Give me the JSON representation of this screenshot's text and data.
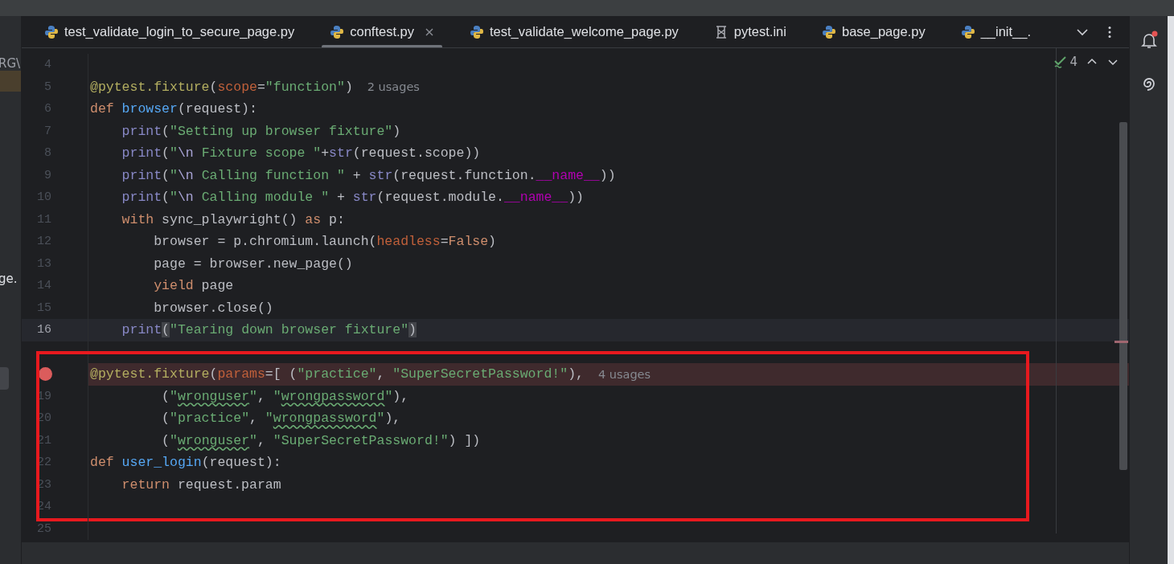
{
  "project_panel": {
    "path_fragment": "RG\\",
    "selected_row": true,
    "file_fragment": "ge."
  },
  "tabs": [
    {
      "label": "test_validate_login_to_secure_page.py",
      "kind": "python",
      "selected": false
    },
    {
      "label": "conftest.py",
      "kind": "python",
      "selected": true
    },
    {
      "label": "test_validate_welcome_page.py",
      "kind": "python",
      "selected": false
    },
    {
      "label": "pytest.ini",
      "kind": "ini",
      "selected": false
    },
    {
      "label": "base_page.py",
      "kind": "python",
      "selected": false
    },
    {
      "label": "__init__.",
      "kind": "python",
      "selected": false
    }
  ],
  "inspections": {
    "count": "4"
  },
  "code_blocks": [
    {
      "framed": false,
      "lines": [
        {
          "number": "4",
          "current": false,
          "breakpoint": false
        },
        {
          "number": "5",
          "current": false,
          "breakpoint": false,
          "tokens": [
            {
              "kind": "deco",
              "text": "@pytest.fixture"
            },
            {
              "kind": "plain",
              "text": "("
            },
            {
              "kind": "param",
              "text": "scope"
            },
            {
              "kind": "plain",
              "text": "="
            },
            {
              "kind": "str",
              "text": "\"function\""
            },
            {
              "kind": "plain",
              "text": ")"
            }
          ],
          "hint": "2 usages"
        },
        {
          "number": "6",
          "current": false,
          "breakpoint": false,
          "tokens": [
            {
              "kind": "kw",
              "text": "def "
            },
            {
              "kind": "def",
              "text": "browser"
            },
            {
              "kind": "plain",
              "text": "(request):"
            }
          ]
        },
        {
          "number": "7",
          "current": false,
          "breakpoint": false,
          "tokens": [
            {
              "kind": "builtin",
              "text": "    print"
            },
            {
              "kind": "plain",
              "text": "("
            },
            {
              "kind": "str",
              "text": "\"Setting up browser fixture\""
            },
            {
              "kind": "plain",
              "text": ")"
            }
          ]
        },
        {
          "number": "8",
          "current": false,
          "breakpoint": false,
          "tokens": [
            {
              "kind": "builtin",
              "text": "    print"
            },
            {
              "kind": "plain",
              "text": "("
            },
            {
              "kind": "str",
              "text": "\""
            },
            {
              "kind": "escape",
              "text": "\\n"
            },
            {
              "kind": "str",
              "text": " Fixture scope \""
            },
            {
              "kind": "plain",
              "text": "+"
            },
            {
              "kind": "builtin",
              "text": "str"
            },
            {
              "kind": "plain",
              "text": "(request.scope))"
            }
          ]
        },
        {
          "number": "9",
          "current": false,
          "breakpoint": false,
          "tokens": [
            {
              "kind": "builtin",
              "text": "    print"
            },
            {
              "kind": "plain",
              "text": "("
            },
            {
              "kind": "str",
              "text": "\""
            },
            {
              "kind": "escape",
              "text": "\\n"
            },
            {
              "kind": "str",
              "text": " Calling function \""
            },
            {
              "kind": "plain",
              "text": " + "
            },
            {
              "kind": "builtin",
              "text": "str"
            },
            {
              "kind": "plain",
              "text": "(request.function."
            },
            {
              "kind": "dunder",
              "text": "__name__"
            },
            {
              "kind": "plain",
              "text": "))"
            }
          ]
        },
        {
          "number": "10",
          "current": false,
          "breakpoint": false,
          "tokens": [
            {
              "kind": "builtin",
              "text": "    print"
            },
            {
              "kind": "plain",
              "text": "("
            },
            {
              "kind": "str",
              "text": "\""
            },
            {
              "kind": "escape",
              "text": "\\n"
            },
            {
              "kind": "str",
              "text": " Calling module \""
            },
            {
              "kind": "plain",
              "text": " + "
            },
            {
              "kind": "builtin",
              "text": "str"
            },
            {
              "kind": "plain",
              "text": "(request.module."
            },
            {
              "kind": "dunder",
              "text": "__name__"
            },
            {
              "kind": "plain",
              "text": "))"
            }
          ]
        },
        {
          "number": "11",
          "current": false,
          "breakpoint": false,
          "tokens": [
            {
              "kind": "kw",
              "text": "    with "
            },
            {
              "kind": "plain",
              "text": "sync_playwright() "
            },
            {
              "kind": "kw",
              "text": "as "
            },
            {
              "kind": "plain",
              "text": "p:"
            }
          ]
        },
        {
          "number": "12",
          "current": false,
          "breakpoint": false,
          "tokens": [
            {
              "kind": "plain",
              "text": "        browser = p.chromium.launch("
            },
            {
              "kind": "param",
              "text": "headless"
            },
            {
              "kind": "plain",
              "text": "="
            },
            {
              "kind": "kw",
              "text": "False"
            },
            {
              "kind": "plain",
              "text": ")"
            }
          ]
        },
        {
          "number": "13",
          "current": false,
          "breakpoint": false,
          "tokens": [
            {
              "kind": "plain",
              "text": "        page = browser.new_page()"
            }
          ]
        },
        {
          "number": "14",
          "current": false,
          "breakpoint": false,
          "tokens": [
            {
              "kind": "kw",
              "text": "        yield "
            },
            {
              "kind": "plain",
              "text": "page"
            }
          ]
        },
        {
          "number": "15",
          "current": false,
          "breakpoint": false,
          "tokens": [
            {
              "kind": "plain",
              "text": "        browser.close()"
            }
          ]
        },
        {
          "number": "16",
          "current": true,
          "breakpoint": false,
          "tokens": [
            {
              "kind": "builtin",
              "text": "    print"
            },
            {
              "kind": "match",
              "text": "("
            },
            {
              "kind": "str",
              "text": "\"Tearing down browser fixture\""
            },
            {
              "kind": "match",
              "text": ")"
            }
          ]
        },
        {
          "current": false,
          "breakpoint": false
        }
      ]
    },
    {
      "framed": true,
      "lines": [
        {
          "current": false,
          "breakpoint": true,
          "tokens": [
            {
              "kind": "deco",
              "text": "@pytest.fixture"
            },
            {
              "kind": "plain",
              "text": "("
            },
            {
              "kind": "param",
              "text": "params"
            },
            {
              "kind": "plain",
              "text": "=[ ("
            },
            {
              "kind": "str",
              "text": "\"practice\""
            },
            {
              "kind": "plain",
              "text": ", "
            },
            {
              "kind": "str",
              "text": "\"SuperSecretPassword!\""
            },
            {
              "kind": "plain",
              "text": "),"
            }
          ],
          "hint": "4 usages"
        },
        {
          "number": "19",
          "current": false,
          "breakpoint": false,
          "tokens": [
            {
              "kind": "plain",
              "text": "         ("
            },
            {
              "kind": "str",
              "text": "\""
            },
            {
              "kind": "typo",
              "text": "wronguser"
            },
            {
              "kind": "str",
              "text": "\""
            },
            {
              "kind": "plain",
              "text": ", "
            },
            {
              "kind": "str",
              "text": "\""
            },
            {
              "kind": "typo",
              "text": "wrongpassword"
            },
            {
              "kind": "str",
              "text": "\""
            },
            {
              "kind": "plain",
              "text": "),"
            }
          ]
        },
        {
          "number": "20",
          "current": false,
          "breakpoint": false,
          "tokens": [
            {
              "kind": "plain",
              "text": "         ("
            },
            {
              "kind": "str",
              "text": "\"practice\""
            },
            {
              "kind": "plain",
              "text": ", "
            },
            {
              "kind": "str",
              "text": "\""
            },
            {
              "kind": "typo",
              "text": "wrongpassword"
            },
            {
              "kind": "str",
              "text": "\""
            },
            {
              "kind": "plain",
              "text": "),"
            }
          ]
        },
        {
          "number": "21",
          "current": false,
          "breakpoint": false,
          "tokens": [
            {
              "kind": "plain",
              "text": "         ("
            },
            {
              "kind": "str",
              "text": "\""
            },
            {
              "kind": "typo",
              "text": "wronguser"
            },
            {
              "kind": "str",
              "text": "\""
            },
            {
              "kind": "plain",
              "text": ", "
            },
            {
              "kind": "str",
              "text": "\"SuperSecretPassword!\""
            },
            {
              "kind": "plain",
              "text": ") ])"
            }
          ]
        },
        {
          "number": "22",
          "current": false,
          "breakpoint": false,
          "tokens": [
            {
              "kind": "kw",
              "text": "def "
            },
            {
              "kind": "def",
              "text": "user_login"
            },
            {
              "kind": "plain",
              "text": "(request):"
            }
          ]
        },
        {
          "number": "23",
          "current": false,
          "breakpoint": false,
          "tokens": [
            {
              "kind": "kw",
              "text": "    return "
            },
            {
              "kind": "plain",
              "text": "request.param"
            }
          ]
        },
        {
          "number": "24",
          "current": false,
          "breakpoint": false
        }
      ]
    },
    {
      "framed": false,
      "lines": [
        {
          "number": "25",
          "current": false,
          "breakpoint": false
        }
      ]
    }
  ]
}
